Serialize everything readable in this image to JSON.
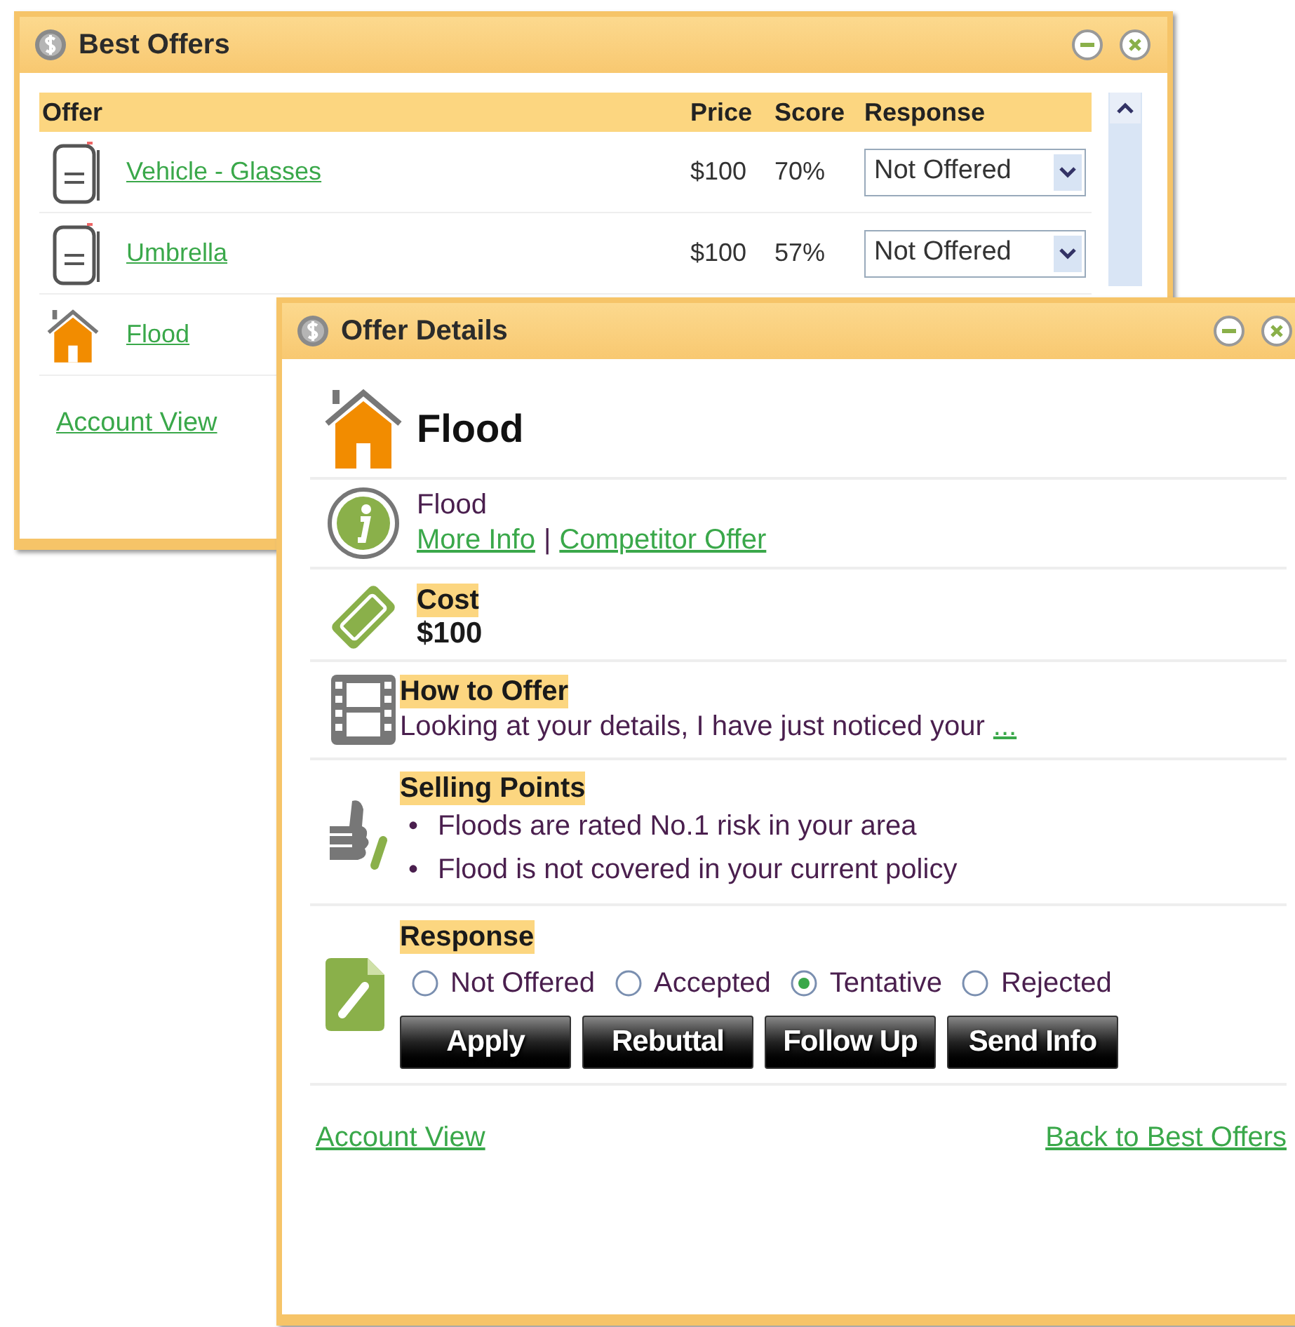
{
  "best_offers": {
    "title": "Best Offers",
    "columns": [
      "Offer",
      "Price",
      "Score",
      "Response"
    ],
    "rows": [
      {
        "kind": "document",
        "offer": "Vehicle - Glasses",
        "price": "$100",
        "score": "70%",
        "response": "Not Offered"
      },
      {
        "kind": "document",
        "offer": "Umbrella",
        "price": "$100",
        "score": "57%",
        "response": "Not Offered"
      },
      {
        "kind": "house",
        "offer": "Flood"
      }
    ],
    "link": "Account View"
  },
  "offer_details": {
    "title": "Offer Details",
    "product": "Flood",
    "info": {
      "text": "Flood",
      "links": [
        "More Info",
        "Competitor Offer"
      ],
      "separator": "|"
    },
    "cost": {
      "heading": "Cost",
      "value": "$100"
    },
    "how_to_offer": {
      "heading": "How to Offer",
      "text": "Looking at your details, I have just noticed your",
      "more": "..."
    },
    "selling_points": {
      "heading": "Selling Points",
      "bullets": [
        {
          "marker": "•",
          "text": "Floods are rated No.1 risk in your area"
        },
        {
          "marker": "•",
          "text": "Flood is not covered in your current policy"
        }
      ]
    },
    "response": {
      "heading": "Response",
      "options": [
        {
          "label": "Not Offered",
          "selected": false
        },
        {
          "label": "Accepted",
          "selected": false
        },
        {
          "label": "Tentative",
          "selected": true
        },
        {
          "label": "Rejected",
          "selected": false
        }
      ]
    },
    "buttons": [
      "Apply",
      "Rebuttal",
      "Follow Up",
      "Send Info"
    ],
    "links": [
      "Account View",
      "Back to Best Offers"
    ]
  }
}
